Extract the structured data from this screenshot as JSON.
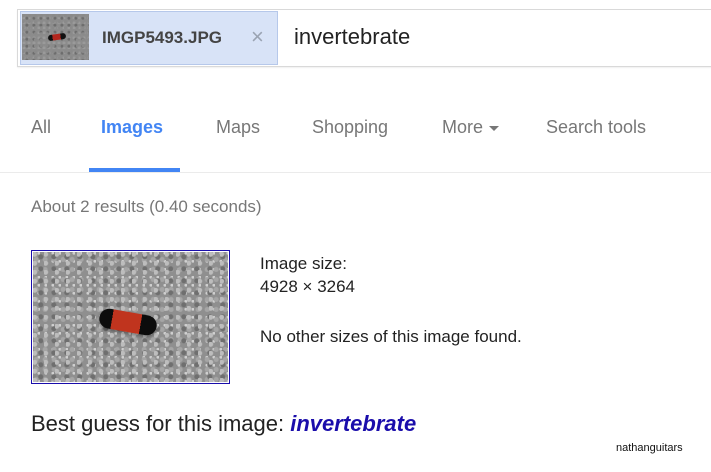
{
  "search": {
    "image_chip": {
      "filename": "IMGP5493.JPG",
      "close_glyph": "×",
      "thumbnail_icon": "caterpillar-thumbnail"
    },
    "query": "invertebrate"
  },
  "tabs": [
    {
      "label": "All",
      "active": false
    },
    {
      "label": "Images",
      "active": true
    },
    {
      "label": "Maps",
      "active": false
    },
    {
      "label": "Shopping",
      "active": false
    },
    {
      "label": "More",
      "active": false
    },
    {
      "label": "Search tools",
      "active": false
    }
  ],
  "results_count": "About 2 results (0.40 seconds)",
  "result": {
    "image_size_label": "Image size:",
    "image_size_value": "4928 × 3264",
    "no_other_sizes": "No other sizes of this image found."
  },
  "best_guess": {
    "label": "Best guess for this image: ",
    "link_text": "invertebrate"
  },
  "watermark": "nathanguitars",
  "colors": {
    "accent": "#4285f4",
    "link": "#1a0dab",
    "chip_bg": "#d8e3f7"
  }
}
